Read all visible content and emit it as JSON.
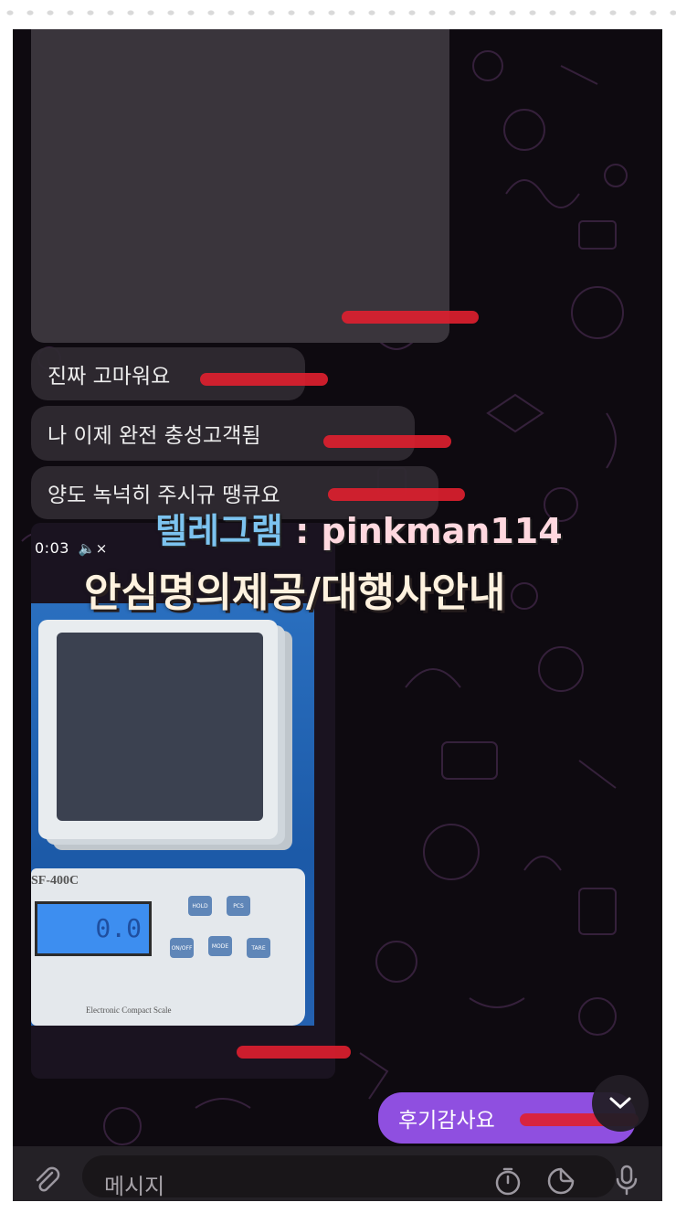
{
  "messages": {
    "incoming": [
      {
        "text": "진짜 고마워요"
      },
      {
        "text": "나 이제 완전 충성고객됨"
      },
      {
        "text": "양도 녹넉히 주시규 땡큐요"
      }
    ],
    "media": {
      "duration": "0:03",
      "scale_model": "SF-400C",
      "scale_brand": "Electronic Compact Scale",
      "keys": [
        "HOLD",
        "PCS",
        "ON/OFF",
        "MODE",
        "TARE"
      ]
    },
    "outgoing": [
      {
        "text": "후기감사요"
      }
    ]
  },
  "overlay": {
    "line1_label": "텔레그램",
    "line1_sep": " : ",
    "line1_handle": "pinkman114",
    "line2": "안심명의제공/대행사안내"
  },
  "composer": {
    "placeholder": "메시지"
  },
  "icons": {
    "attach": "paperclip-icon",
    "timer": "timer-icon",
    "sticker": "sticker-icon",
    "mic": "microphone-icon",
    "mute": "muted-speaker-icon",
    "scroll_down": "chevron-down-icon"
  },
  "colors": {
    "background": "#0e0a10",
    "incoming_bubble": "#2f2a32",
    "outgoing_bubble": "#8f4fe0",
    "redaction": "#e01f2f"
  }
}
